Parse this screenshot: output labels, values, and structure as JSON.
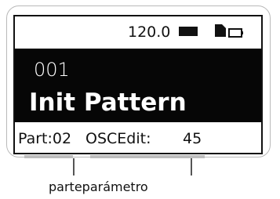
{
  "status": {
    "tempo": "120.0",
    "tempo_icon": "bar-block-icon",
    "doc_icon": "pattern-file-icon",
    "battery_icon": "battery-icon"
  },
  "pattern": {
    "number": "001",
    "name": "Init Pattern"
  },
  "bottom": {
    "part": "Part:02",
    "param_name": "OSCEdit:",
    "param_value": "45"
  },
  "annotation": {
    "caption": "parteparámetro"
  },
  "colors": {
    "lcd_background": "#ffffff",
    "inverted_block": "#060606",
    "bracket": "#bdbdbd"
  }
}
